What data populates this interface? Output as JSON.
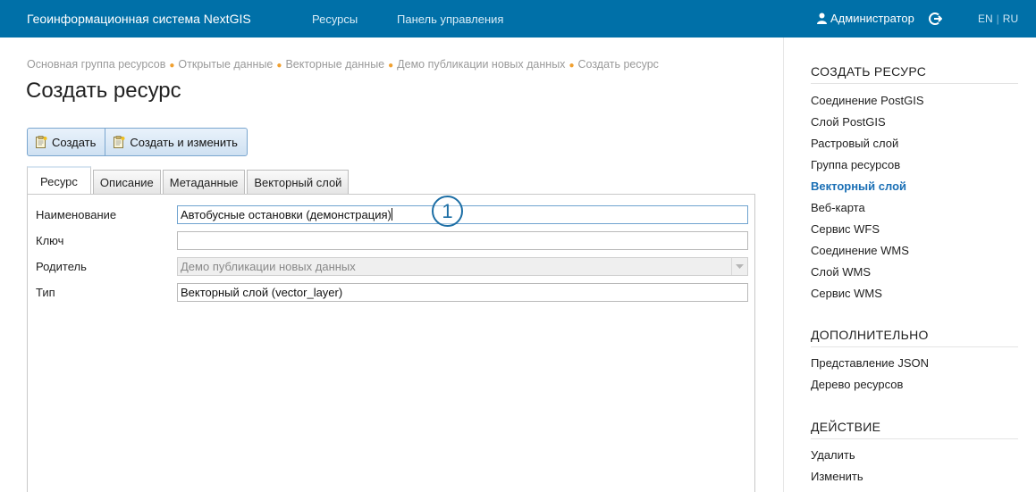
{
  "header": {
    "app_title": "Геоинформационная система NextGIS",
    "nav": [
      "Ресурсы",
      "Панель управления"
    ],
    "user": "Администратор",
    "lang_en": "EN",
    "lang_ru": "RU",
    "bg_color": "#0070a8"
  },
  "breadcrumb": [
    "Основная группа ресурсов",
    "Открытые данные",
    "Векторные данные",
    "Демо публикации новых данных",
    "Создать ресурс"
  ],
  "page_title": "Создать ресурс",
  "toolbar": {
    "create_label": "Создать",
    "create_edit_label": "Создать и изменить"
  },
  "tabs": [
    "Ресурс",
    "Описание",
    "Метаданные",
    "Векторный слой"
  ],
  "form": {
    "name_label": "Наименование",
    "name_value": "Автобусные остановки (демонстрация)",
    "key_label": "Ключ",
    "key_value": "",
    "parent_label": "Родитель",
    "parent_value": "Демо публикации новых данных",
    "type_label": "Тип",
    "type_value": "Векторный слой (vector_layer)"
  },
  "callout_number": "1",
  "sidebar": {
    "create_heading": "СОЗДАТЬ РЕСУРС",
    "create_items": [
      "Соединение PostGIS",
      "Слой PostGIS",
      "Растровый слой",
      "Группа ресурсов",
      "Векторный слой",
      "Веб-карта",
      "Сервис WFS",
      "Соединение WMS",
      "Слой WMS",
      "Сервис WMS"
    ],
    "active_item": "Векторный слой",
    "extra_heading": "ДОПОЛНИТЕЛЬНО",
    "extra_items": [
      "Представление JSON",
      "Дерево ресурсов"
    ],
    "action_heading": "ДЕЙСТВИЕ",
    "action_items": [
      "Удалить",
      "Изменить"
    ],
    "accent_color": "#1a6fb5"
  }
}
